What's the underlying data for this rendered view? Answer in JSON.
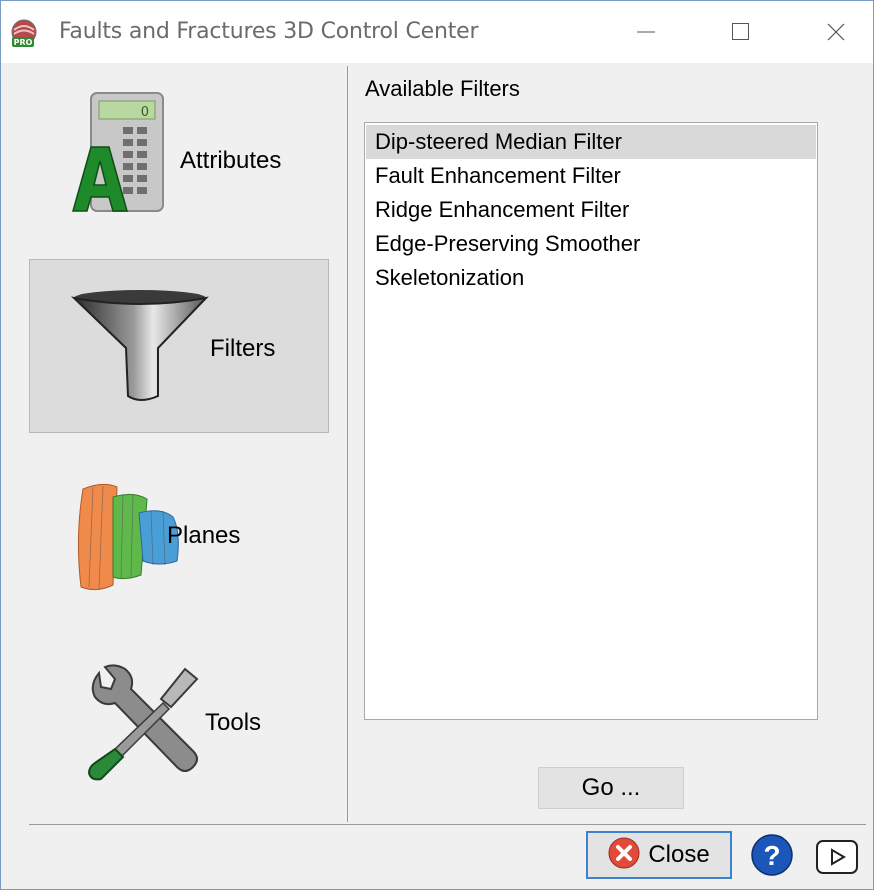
{
  "window": {
    "title": "Faults and Fractures 3D Control Center"
  },
  "titlebar_buttons": {
    "minimize": "minimize-icon",
    "maximize": "maximize-icon",
    "close": "close-icon"
  },
  "sidebar": {
    "items": [
      {
        "label": "Attributes",
        "icon": "calculator-icon",
        "selected": false
      },
      {
        "label": "Filters",
        "icon": "funnel-icon",
        "selected": true
      },
      {
        "label": "Planes",
        "icon": "planes-icon",
        "selected": false
      },
      {
        "label": "Tools",
        "icon": "tools-icon",
        "selected": false
      }
    ]
  },
  "main": {
    "title": "Available Filters",
    "filters": [
      "Dip-steered Median Filter",
      "Fault Enhancement Filter",
      "Ridge Enhancement Filter",
      "Edge-Preserving Smoother",
      "Skeletonization"
    ],
    "selected_index": 0,
    "go_label": "Go ..."
  },
  "footer": {
    "close_label": "Close",
    "help_icon": "help-icon",
    "play_icon": "play-icon"
  }
}
